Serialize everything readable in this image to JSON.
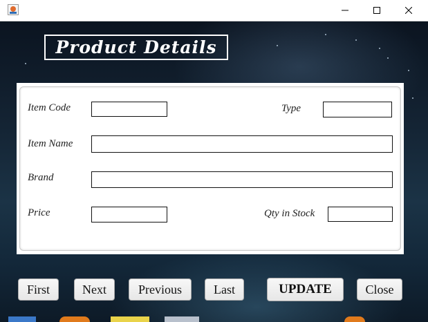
{
  "window": {
    "icon": "java-cup-icon",
    "controls": [
      "minimize-icon",
      "maximize-icon",
      "close-icon"
    ]
  },
  "header": {
    "title": "Product Details"
  },
  "form": {
    "item_code": {
      "label": "Item Code",
      "value": ""
    },
    "type": {
      "label": "Type",
      "value": ""
    },
    "item_name": {
      "label": "Item Name",
      "value": ""
    },
    "brand": {
      "label": "Brand",
      "value": ""
    },
    "price": {
      "label": "Price",
      "value": ""
    },
    "qty": {
      "label": "Qty in Stock",
      "value": ""
    }
  },
  "buttons": {
    "first": "First",
    "next": "Next",
    "previous": "Previous",
    "last": "Last",
    "update": "UPDATE",
    "close": "Close"
  },
  "colors": {
    "background": "#0f1a26",
    "panel": "#ffffff",
    "title_border": "#ffffff"
  }
}
